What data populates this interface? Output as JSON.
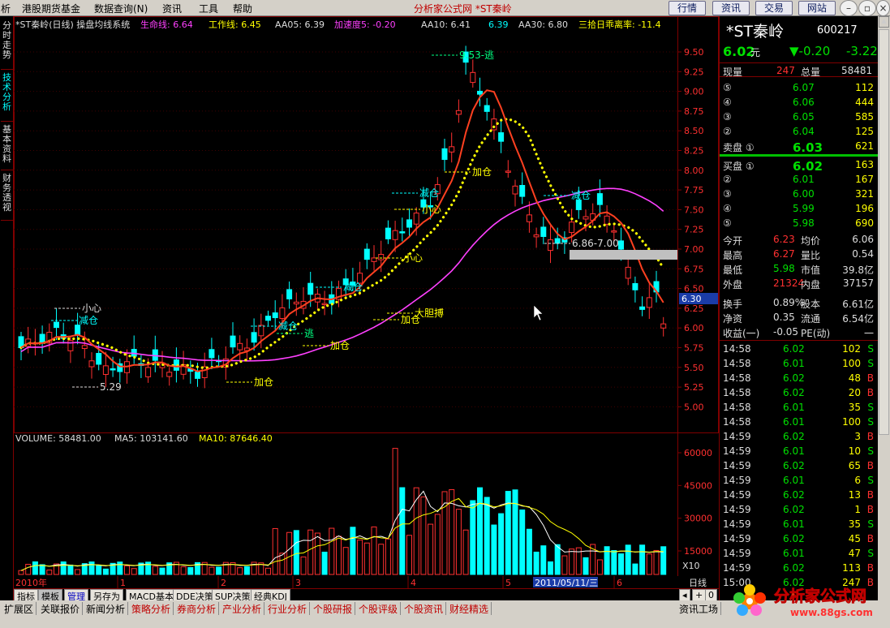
{
  "menubar": {
    "items": [
      "析",
      "港股期货基金",
      "数据查询(N)",
      "资讯",
      "工具",
      "帮助"
    ],
    "title": "分析家公式网 *ST秦岭",
    "buttons": [
      "行情",
      "资讯",
      "交易",
      "网站"
    ]
  },
  "left_tabs": [
    "分时走势",
    "技术分析",
    "基本资料",
    "财务透视"
  ],
  "chart_header": {
    "name": "*ST秦岭(日线) 操盘均线系统",
    "lifeline": "生命线: 6.64",
    "workline": "工作线: 6.45",
    "aa05": "AA05: 6.39",
    "accel": "加速度5: -0.20",
    "aa10": "AA10: 6.41",
    "val": "6.39",
    "aa30": "AA30: 6.80",
    "ratio": "三拾日乖离率: -11.4"
  },
  "price_axis": [
    "9.50",
    "9.25",
    "9.00",
    "8.75",
    "8.50",
    "8.25",
    "8.00",
    "7.75",
    "7.50",
    "7.25",
    "7.00",
    "6.75",
    "6.50",
    "6.25",
    "6.00",
    "5.75",
    "5.50",
    "5.25",
    "5.00"
  ],
  "current_price_tag": "6.30",
  "chart_annotations": {
    "peak": "9.53-逃",
    "low": "5.29",
    "range": "6.86-7.00",
    "xiaoxin1": "小心",
    "jiancang1": "减仓",
    "xiaoxin2": "小心",
    "xiaoxin3": "小心",
    "jiancang2": "减仓",
    "jiancang3": "减仓",
    "jiancang4": "减仓",
    "jiancang5": "减仓",
    "tao1": "逃",
    "jiacang1": "加仓",
    "jiacang2": "加仓",
    "jiacang3": "加仓",
    "jiacang4": "加仓",
    "dadanbo": "大胆搏"
  },
  "volume_header": {
    "volume": "VOLUME: 58481.00",
    "ma5": "MA5: 103141.60",
    "ma10": "MA10: 87646.40"
  },
  "volume_axis": [
    "60000",
    "45000",
    "30000",
    "15000"
  ],
  "vol_unit": "X10",
  "date_axis": {
    "year": "2010年",
    "months": [
      "1",
      "2",
      "3",
      "4",
      "5",
      "6"
    ],
    "cursor_date": "2011/05/11/三",
    "period": "日线"
  },
  "indicator_tabs": [
    "指标",
    "模板",
    "管理",
    "另存为",
    "MACD基本",
    "DDE决策",
    "SUP决策",
    "经典KDJ"
  ],
  "quote": {
    "name": "*ST秦岭",
    "code": "600217",
    "price": "6.02",
    "price_unit": "元",
    "change": "▼-0.20",
    "change_pct": "-3.22",
    "xianliang_label": "现量",
    "xianliang": "247",
    "zongliang_label": "总量",
    "zongliang": "58481",
    "asks": [
      {
        "lvl": "⑤",
        "price": "6.07",
        "vol": "112"
      },
      {
        "lvl": "④",
        "price": "6.06",
        "vol": "444"
      },
      {
        "lvl": "③",
        "price": "6.05",
        "vol": "585"
      },
      {
        "lvl": "②",
        "price": "6.04",
        "vol": "125"
      },
      {
        "lvl": "卖盘 ①",
        "price": "6.03",
        "vol": "621"
      }
    ],
    "bids": [
      {
        "lvl": "买盘 ①",
        "price": "6.02",
        "vol": "163"
      },
      {
        "lvl": "②",
        "price": "6.01",
        "vol": "167"
      },
      {
        "lvl": "③",
        "price": "6.00",
        "vol": "321"
      },
      {
        "lvl": "④",
        "price": "5.99",
        "vol": "196"
      },
      {
        "lvl": "⑤",
        "price": "5.98",
        "vol": "690"
      }
    ],
    "stats": [
      {
        "l1": "今开",
        "v1": "6.23",
        "l2": "均价",
        "v2": "6.06"
      },
      {
        "l1": "最高",
        "v1": "6.27",
        "l2": "量比",
        "v2": "0.54"
      },
      {
        "l1": "最低",
        "v1": "5.98",
        "l2": "市值",
        "v2": "39.8亿"
      },
      {
        "l1": "外盘",
        "v1": "21324",
        "l2": "内盘",
        "v2": "37157"
      }
    ],
    "stats2": [
      {
        "l1": "换手",
        "v1": "0.89%",
        "l2": "股本",
        "v2": "6.61亿"
      },
      {
        "l1": "净资",
        "v1": "0.35",
        "l2": "流通",
        "v2": "6.54亿"
      },
      {
        "l1": "收益(一)",
        "v1": "-0.05",
        "l2": "PE(动)",
        "v2": "一"
      }
    ],
    "ticks": [
      {
        "t": "14:58",
        "p": "6.02",
        "v": "102",
        "d": "S"
      },
      {
        "t": "14:58",
        "p": "6.01",
        "v": "100",
        "d": "S"
      },
      {
        "t": "14:58",
        "p": "6.02",
        "v": "48",
        "d": "B"
      },
      {
        "t": "14:58",
        "p": "6.02",
        "v": "20",
        "d": "B"
      },
      {
        "t": "14:58",
        "p": "6.01",
        "v": "35",
        "d": "S"
      },
      {
        "t": "14:58",
        "p": "6.01",
        "v": "100",
        "d": "S"
      },
      {
        "t": "14:59",
        "p": "6.02",
        "v": "3",
        "d": "B"
      },
      {
        "t": "14:59",
        "p": "6.01",
        "v": "10",
        "d": "S"
      },
      {
        "t": "14:59",
        "p": "6.02",
        "v": "65",
        "d": "B"
      },
      {
        "t": "14:59",
        "p": "6.01",
        "v": "6",
        "d": "S"
      },
      {
        "t": "14:59",
        "p": "6.02",
        "v": "13",
        "d": "B"
      },
      {
        "t": "14:59",
        "p": "6.02",
        "v": "1",
        "d": "B"
      },
      {
        "t": "14:59",
        "p": "6.01",
        "v": "35",
        "d": "S"
      },
      {
        "t": "14:59",
        "p": "6.02",
        "v": "45",
        "d": "B"
      },
      {
        "t": "14:59",
        "p": "6.01",
        "v": "47",
        "d": "S"
      },
      {
        "t": "14:59",
        "p": "6.02",
        "v": "113",
        "d": "B"
      },
      {
        "t": "15:00",
        "p": "6.02",
        "v": "247",
        "d": "B"
      }
    ]
  },
  "bottom_tabs": [
    "扩展区",
    "关联报价",
    "新闻分析",
    "策略分析",
    "券商分析",
    "产业分析",
    "行业分析",
    "个股研报",
    "个股评级",
    "个股资讯",
    "财经精选"
  ],
  "bottom_right": "资讯工场",
  "watermark": {
    "text": "分析家公式网",
    "url": "www.88gs.com"
  },
  "colors": {
    "up": "#ff3030",
    "down": "#00ffff",
    "lifeline": "#ff40ff",
    "workline": "#ffff00",
    "bg": "#000000",
    "grid": "#800000"
  }
}
